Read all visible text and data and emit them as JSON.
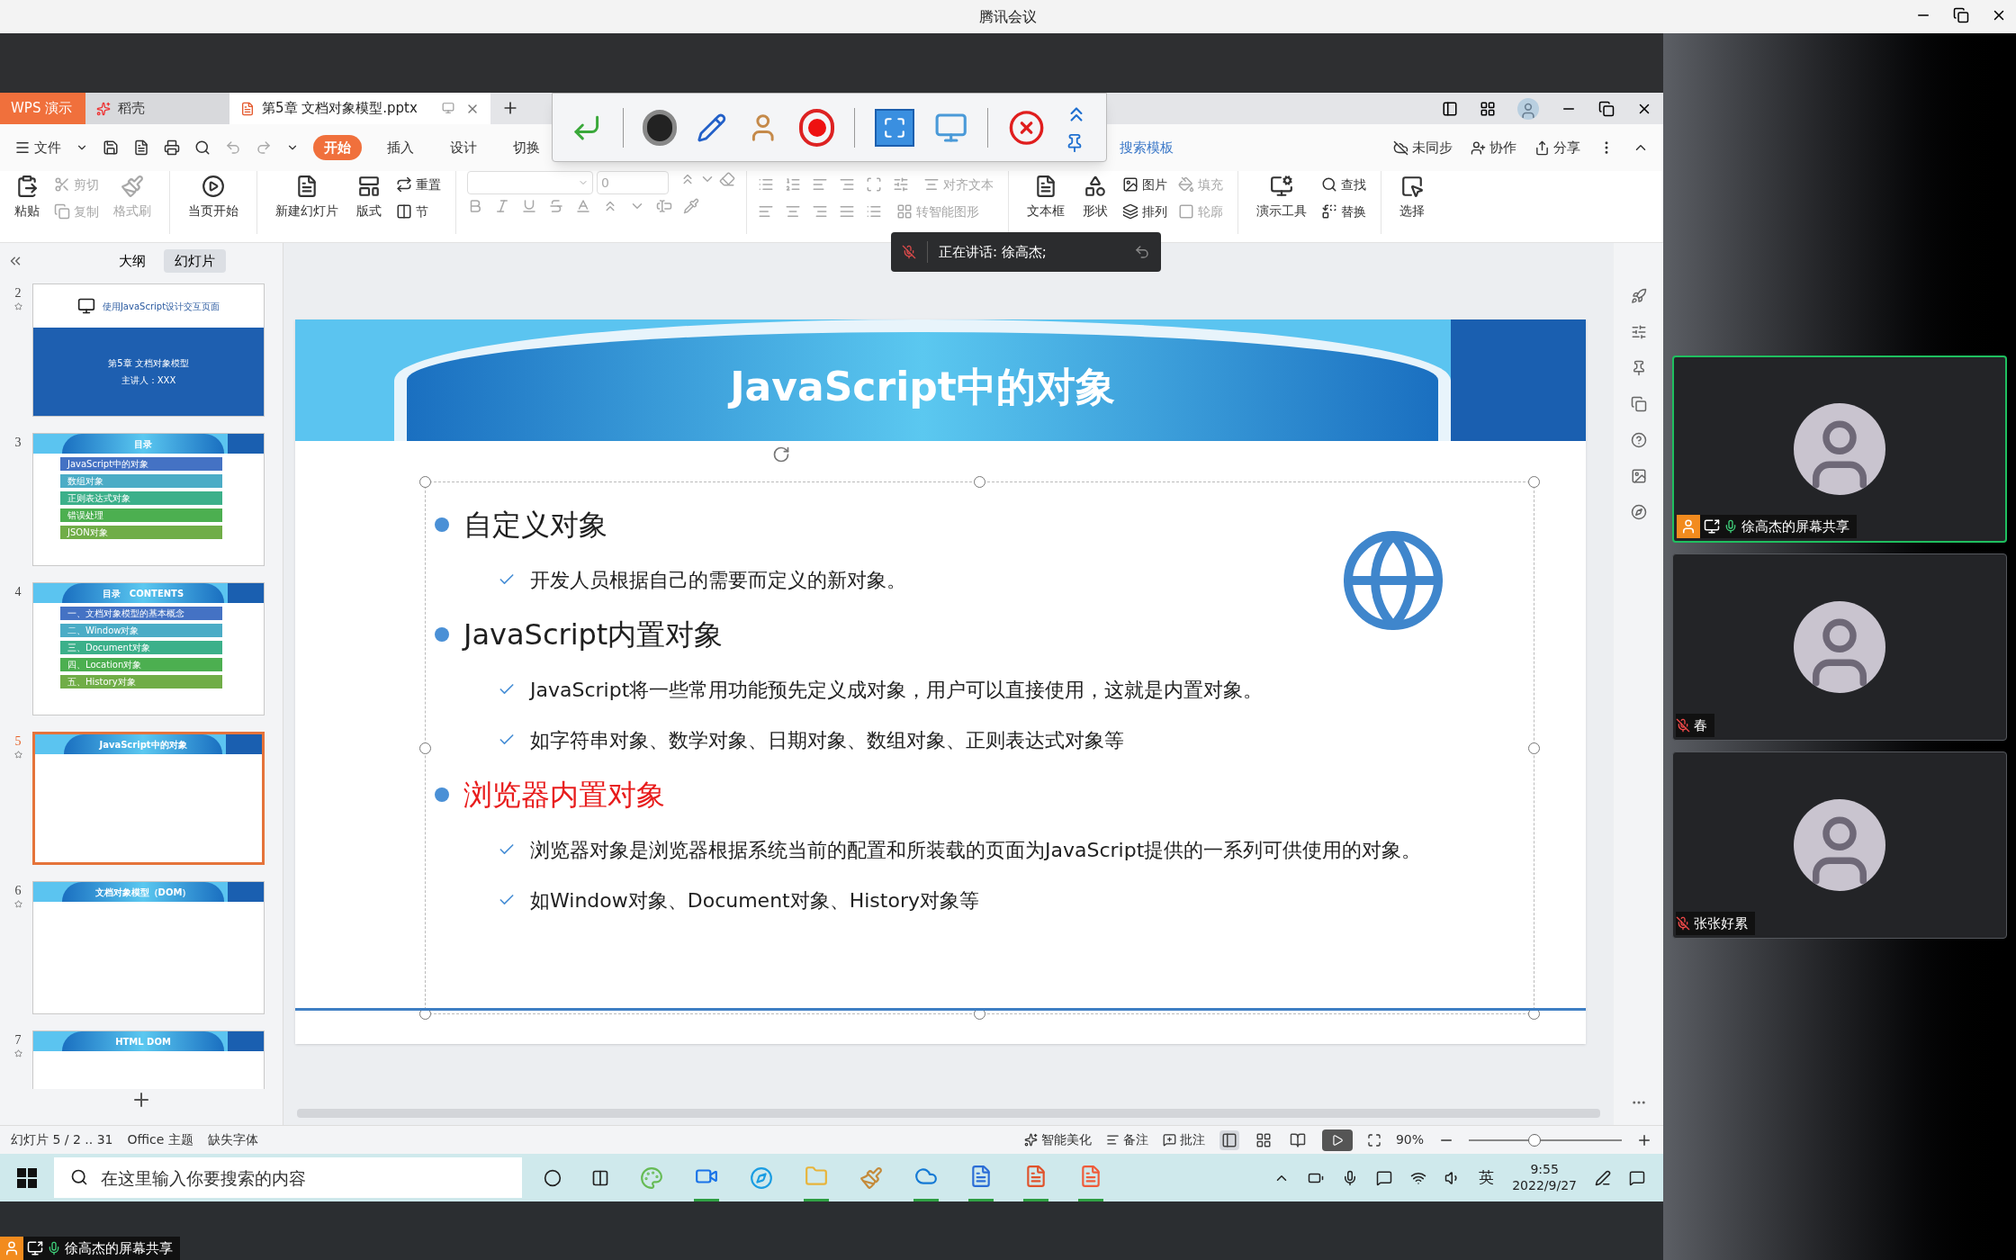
{
  "meeting_window": {
    "title": "腾讯会议"
  },
  "app_tabs": [
    {
      "label": "WPS 演示",
      "kind": "brand",
      "selected": false
    },
    {
      "label": "稻壳",
      "kind": "docer",
      "selected": false
    },
    {
      "label": "第5章 文档对象模型.pptx",
      "kind": "doc",
      "selected": true
    }
  ],
  "file_menu": "文件",
  "ribbon_tabs": [
    {
      "label": "开始",
      "selected": true
    },
    {
      "label": "插入",
      "selected": false
    },
    {
      "label": "设计",
      "selected": false
    },
    {
      "label": "切换",
      "selected": false
    }
  ],
  "search_template": "搜索模板",
  "cloud_actions": [
    "未同步",
    "协作",
    "分享"
  ],
  "ribbon": {
    "paste": {
      "label": "粘贴",
      "disabled": false
    },
    "cut": {
      "label": "剪切",
      "disabled": true
    },
    "copy": {
      "label": "复制",
      "disabled": true
    },
    "format_painter": {
      "label": "格式刷",
      "disabled": true
    },
    "play_from_current": {
      "label": "当页开始",
      "disabled": false
    },
    "new_slide": {
      "label": "新建幻灯片",
      "disabled": false
    },
    "layout": {
      "label": "版式",
      "disabled": false
    },
    "reset": {
      "label": "重置",
      "disabled": false
    },
    "section": {
      "label": "节",
      "disabled": false
    },
    "font_size": {
      "value": "0"
    },
    "align_text": {
      "label": "对齐文本",
      "disabled": true
    },
    "smart_art": {
      "label": "转智能图形",
      "disabled": true
    },
    "text_box": {
      "label": "文本框",
      "disabled": false
    },
    "shapes": {
      "label": "形状",
      "disabled": false
    },
    "picture": {
      "label": "图片",
      "disabled": false
    },
    "arrange": {
      "label": "排列",
      "disabled": false
    },
    "fill": {
      "label": "填充",
      "disabled": true
    },
    "outline": {
      "label": "轮廓",
      "disabled": true
    },
    "presentation_tools": {
      "label": "演示工具",
      "disabled": false
    },
    "find": {
      "label": "查找",
      "disabled": false
    },
    "replace": {
      "label": "替换",
      "disabled": false
    },
    "select": {
      "label": "选择",
      "disabled": false
    }
  },
  "speaking_tooltip": "正在讲话: 徐高杰;",
  "panel_tabs": [
    {
      "label": "大纲",
      "selected": false
    },
    {
      "label": "幻灯片",
      "selected": true
    }
  ],
  "thumbnails": [
    {
      "number": "2",
      "selected": false,
      "animated": true,
      "kind": "cover",
      "title": "使用JavaScript设计交互页面",
      "lines": [
        "第5章 文档对象模型",
        "主讲人：XXX"
      ]
    },
    {
      "number": "3",
      "selected": false,
      "animated": false,
      "kind": "list",
      "title": "目录",
      "items": [
        {
          "text": "JavaScript中的对象",
          "color": "#4472c4"
        },
        {
          "text": "数组对象",
          "color": "#4bacc6"
        },
        {
          "text": "正则表达式对象",
          "color": "#3cb08a"
        },
        {
          "text": "错误处理",
          "color": "#4caf50"
        },
        {
          "text": "JSON对象",
          "color": "#70ad47"
        }
      ]
    },
    {
      "number": "4",
      "selected": false,
      "animated": false,
      "kind": "list",
      "title": "目录　CONTENTS",
      "items": [
        {
          "text": "一、文档对象模型的基本概念",
          "color": "#4472c4"
        },
        {
          "text": "二、Window对象",
          "color": "#4bacc6"
        },
        {
          "text": "三、Document对象",
          "color": "#3cb08a"
        },
        {
          "text": "四、Location对象",
          "color": "#4caf50"
        },
        {
          "text": "五、History对象",
          "color": "#70ad47"
        }
      ]
    },
    {
      "number": "5",
      "selected": true,
      "animated": true,
      "kind": "content",
      "title": "JavaScript中的对象"
    },
    {
      "number": "6",
      "selected": false,
      "animated": true,
      "kind": "content",
      "title": "文档对象模型（DOM）"
    },
    {
      "number": "7",
      "selected": false,
      "animated": true,
      "kind": "content",
      "title": "HTML DOM"
    }
  ],
  "slide": {
    "title": "JavaScript中的对象",
    "bullets": [
      {
        "text": "自定义对象",
        "color": "#1f1f1f",
        "children": [
          "开发人员根据自己的需要而定义的新对象。"
        ]
      },
      {
        "text": "JavaScript内置对象",
        "color": "#1f1f1f",
        "children": [
          "JavaScript将一些常用功能预先定义成对象，用户可以直接使用，这就是内置对象。",
          "如字符串对象、数学对象、日期对象、数组对象、正则表达式对象等"
        ]
      },
      {
        "text": "浏览器内置对象",
        "color": "#e81c1c",
        "children": [
          "浏览器对象是浏览器根据系统当前的配置和所装载的页面为JavaScript提供的一系列可供使用的对象。",
          "如Window对象、Document对象、History对象等"
        ]
      }
    ]
  },
  "status_bar": {
    "slide_info": "幻灯片 5 / 2 .. 31",
    "theme": "Office 主题",
    "missing_fonts": "缺失字体",
    "beautify": "智能美化",
    "notes": "备注",
    "comments": "批注",
    "views": [
      {
        "selected": true
      },
      {
        "selected": false
      },
      {
        "selected": false
      }
    ],
    "zoom": "90%",
    "zoom_slider": {
      "level": 0.43
    }
  },
  "taskbar": {
    "search_placeholder": "在这里输入你要搜索的内容",
    "apps": [
      {
        "kind": "picker",
        "running": false
      },
      {
        "kind": "meeting",
        "running": true
      },
      {
        "kind": "edge",
        "running": false
      },
      {
        "kind": "folder",
        "running": true
      },
      {
        "kind": "paint",
        "running": false
      },
      {
        "kind": "cloud",
        "running": true
      },
      {
        "kind": "word",
        "running": true
      },
      {
        "kind": "html",
        "running": true
      },
      {
        "kind": "wps",
        "running": true
      }
    ],
    "ime": "英",
    "time": "9:55",
    "date": "2022/9/27"
  },
  "participants": [
    {
      "name": "徐高杰的屏幕共享",
      "active": true,
      "host": true,
      "sharing": true,
      "muted": false
    },
    {
      "name": "春",
      "active": false,
      "host": false,
      "sharing": false,
      "muted": true
    },
    {
      "name": "张张好累",
      "active": false,
      "host": false,
      "sharing": false,
      "muted": true
    }
  ],
  "share_label": {
    "name": "徐高杰的屏幕共享",
    "host": true,
    "sharing": true,
    "muted": false
  }
}
